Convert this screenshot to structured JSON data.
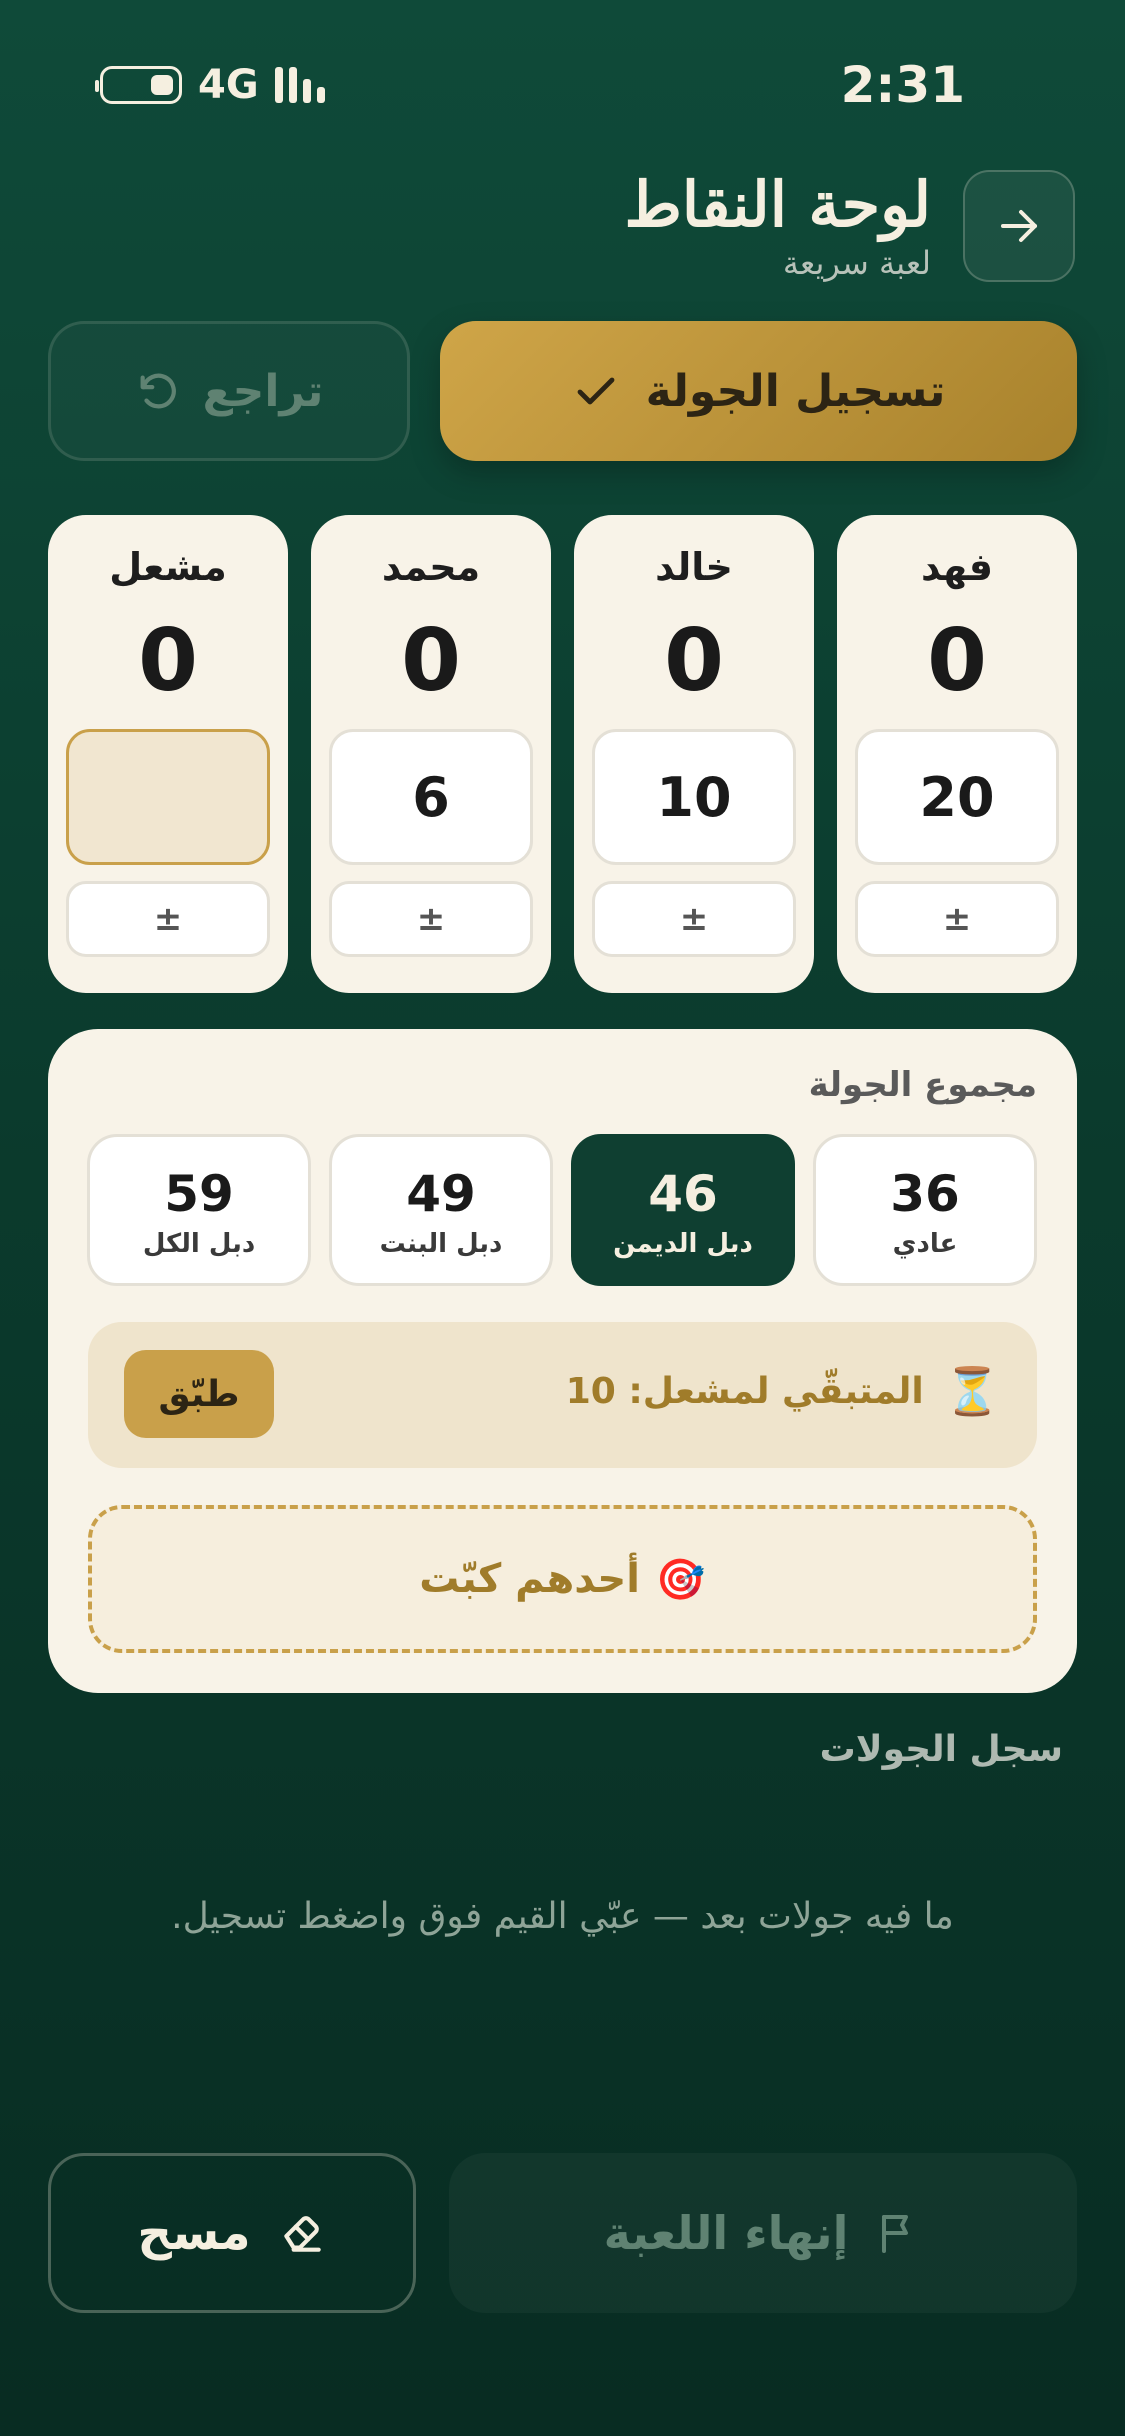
{
  "status_bar": {
    "network": "4G",
    "time": "2:31"
  },
  "header": {
    "title": "لوحة النقاط",
    "subtitle": "لعبة سريعة",
    "back_icon": "arrow-right-icon"
  },
  "actions": {
    "record_label": "تسجيل الجولة",
    "record_icon": "check-icon",
    "undo_label": "تراجع",
    "undo_icon": "undo-icon"
  },
  "players": [
    {
      "name": "فهد",
      "score": "0",
      "round_input": "20",
      "toggle": "±",
      "active": false
    },
    {
      "name": "خالد",
      "score": "0",
      "round_input": "10",
      "toggle": "±",
      "active": false
    },
    {
      "name": "محمد",
      "score": "0",
      "round_input": "6",
      "toggle": "±",
      "active": false
    },
    {
      "name": "مشعل",
      "score": "0",
      "round_input": "",
      "toggle": "±",
      "active": true
    }
  ],
  "round_total": {
    "title": "مجموع الجولة",
    "options": [
      {
        "value": "36",
        "label": "عادي",
        "selected": false
      },
      {
        "value": "46",
        "label": "دبل الديمن",
        "selected": true
      },
      {
        "value": "49",
        "label": "دبل البنت",
        "selected": false
      },
      {
        "value": "59",
        "label": "دبل الكل",
        "selected": false
      }
    ],
    "remaining_text": "المتبقّي لمشعل: 10",
    "remaining_icon": "⏳",
    "apply_label": "طبّق",
    "knock_label": "أحدهم كبّت",
    "knock_icon": "🎯"
  },
  "history": {
    "title": "سجل الجولات",
    "empty_message": "ما فيه جولات بعد — عبّي القيم فوق واضغط تسجيل."
  },
  "bottom": {
    "end_label": "إنهاء اللعبة",
    "end_icon": "flag-icon",
    "clear_label": "مسح",
    "clear_icon": "eraser-icon"
  },
  "colors": {
    "background": "#0b3b2d",
    "accent_gold": "#c9a04a",
    "card": "#f8f3e8",
    "selected": "#0f3f31"
  }
}
